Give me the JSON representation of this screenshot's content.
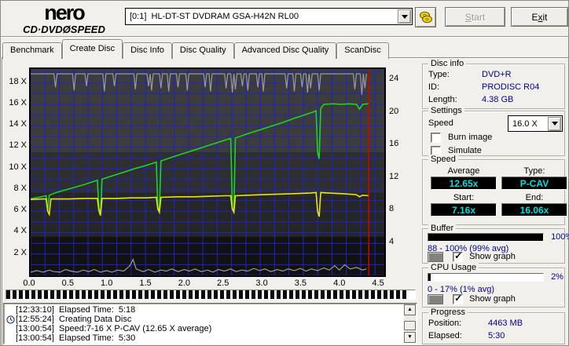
{
  "header": {
    "logo": {
      "line1": "nero",
      "line2_left": "CD·DVD",
      "disc_glyph": "Ø",
      "line2_right": "SPEED"
    },
    "drive_combo": "[0:1]  HL-DT-ST DVDRAM GSA-H42N RL00",
    "start_button": {
      "pre": "",
      "u": "S",
      "rest": "tart"
    },
    "exit_button": {
      "pre": "E",
      "u": "x",
      "rest": "it"
    }
  },
  "tabs": [
    {
      "label": "Benchmark",
      "active": false
    },
    {
      "label": "Create Disc",
      "active": true
    },
    {
      "label": "Disc Info",
      "active": false
    },
    {
      "label": "Disc Quality",
      "active": false
    },
    {
      "label": "Advanced Disc Quality",
      "active": false
    },
    {
      "label": "ScanDisc",
      "active": false
    }
  ],
  "chart_data": {
    "type": "line",
    "x_max": 4.56,
    "y_left_max": 19.3,
    "y_right_max": 25.4,
    "x_ticks": [
      "0.0",
      "0.5",
      "1.0",
      "1.5",
      "2.0",
      "2.5",
      "3.0",
      "3.5",
      "4.0",
      "4.5"
    ],
    "x_tick_values": [
      0,
      0.5,
      1,
      1.5,
      2,
      2.5,
      3,
      3.5,
      4,
      4.5
    ],
    "y_left_ticks": [
      "18 X",
      "16 X",
      "14 X",
      "12 X",
      "10 X",
      "8 X",
      "6 X",
      "4 X",
      "2 X"
    ],
    "y_left_values": [
      18,
      16,
      14,
      12,
      10,
      8,
      6,
      4,
      2
    ],
    "y_right_ticks": [
      "24",
      "20",
      "16",
      "12",
      "8",
      "4"
    ],
    "y_right_values": [
      24,
      20,
      16,
      12,
      8,
      4
    ],
    "grid_color": "#2222c4",
    "grid_dx": 0.185,
    "grid_dy": 1,
    "marker_color": "#d40000",
    "position_marker_x": 4.36,
    "bands": [
      {
        "from": 19.3,
        "to": 11.5,
        "color": "#3c3c3c"
      },
      {
        "from": 11.5,
        "to": 7.7,
        "color": "#2f2f2f"
      },
      {
        "from": 7.7,
        "to": 3.6,
        "color": "#262626"
      },
      {
        "from": 3.6,
        "to": 0,
        "color": "#121212"
      }
    ],
    "series": [
      {
        "name": "write-speed",
        "color": "#1ed51e",
        "width": 1.6,
        "points": [
          [
            0,
            7.16
          ],
          [
            0.1,
            7.3
          ],
          [
            0.2,
            7.45
          ],
          [
            0.22,
            6.0
          ],
          [
            0.24,
            7.5
          ],
          [
            0.35,
            7.8
          ],
          [
            0.5,
            8.1
          ],
          [
            0.65,
            8.4
          ],
          [
            0.8,
            8.75
          ],
          [
            0.86,
            8.9
          ],
          [
            0.88,
            6.3
          ],
          [
            0.9,
            5.8
          ],
          [
            0.92,
            9.0
          ],
          [
            1.05,
            9.3
          ],
          [
            1.2,
            9.65
          ],
          [
            1.35,
            10.0
          ],
          [
            1.5,
            10.3
          ],
          [
            1.62,
            10.6
          ],
          [
            1.64,
            6.4
          ],
          [
            1.66,
            6.1
          ],
          [
            1.68,
            10.7
          ],
          [
            1.8,
            11.0
          ],
          [
            1.95,
            11.35
          ],
          [
            2.1,
            11.7
          ],
          [
            2.25,
            12.05
          ],
          [
            2.4,
            12.4
          ],
          [
            2.55,
            12.75
          ],
          [
            2.58,
            12.8
          ],
          [
            2.6,
            6.3
          ],
          [
            2.62,
            6.0
          ],
          [
            2.64,
            12.85
          ],
          [
            2.8,
            13.25
          ],
          [
            2.95,
            13.6
          ],
          [
            3.1,
            13.95
          ],
          [
            3.25,
            14.3
          ],
          [
            3.4,
            14.7
          ],
          [
            3.55,
            15.05
          ],
          [
            3.65,
            15.3
          ],
          [
            3.68,
            15.4
          ],
          [
            3.7,
            11.5
          ],
          [
            3.72,
            10.9
          ],
          [
            3.74,
            15.6
          ],
          [
            3.78,
            16.0
          ],
          [
            3.9,
            16.05
          ],
          [
            4.0,
            16.0
          ],
          [
            4.1,
            16.05
          ],
          [
            4.2,
            16.0
          ],
          [
            4.24,
            15.55
          ],
          [
            4.28,
            16.0
          ],
          [
            4.36,
            16.06
          ]
        ]
      },
      {
        "name": "rotation-speed",
        "color": "#e8e800",
        "width": 1.6,
        "points": [
          [
            0,
            7.1
          ],
          [
            0.15,
            7.15
          ],
          [
            0.2,
            7.15
          ],
          [
            0.22,
            6.0
          ],
          [
            0.24,
            5.7
          ],
          [
            0.26,
            7.15
          ],
          [
            0.5,
            7.15
          ],
          [
            0.7,
            7.2
          ],
          [
            0.86,
            7.2
          ],
          [
            0.88,
            6.1
          ],
          [
            0.9,
            5.6
          ],
          [
            0.92,
            7.2
          ],
          [
            1.1,
            7.2
          ],
          [
            1.3,
            7.25
          ],
          [
            1.5,
            7.25
          ],
          [
            1.62,
            7.3
          ],
          [
            1.64,
            6.2
          ],
          [
            1.66,
            5.9
          ],
          [
            1.68,
            7.3
          ],
          [
            1.9,
            7.35
          ],
          [
            2.1,
            7.35
          ],
          [
            2.3,
            7.4
          ],
          [
            2.5,
            7.45
          ],
          [
            2.58,
            7.45
          ],
          [
            2.6,
            6.2
          ],
          [
            2.62,
            5.9
          ],
          [
            2.64,
            7.45
          ],
          [
            2.8,
            7.5
          ],
          [
            3.0,
            7.55
          ],
          [
            3.2,
            7.6
          ],
          [
            3.4,
            7.65
          ],
          [
            3.6,
            7.7
          ],
          [
            3.68,
            7.75
          ],
          [
            3.7,
            6.0
          ],
          [
            3.72,
            5.5
          ],
          [
            3.74,
            7.75
          ],
          [
            3.85,
            7.7
          ],
          [
            4.0,
            7.65
          ],
          [
            4.1,
            7.6
          ],
          [
            4.2,
            7.55
          ],
          [
            4.24,
            7.35
          ],
          [
            4.28,
            7.5
          ],
          [
            4.36,
            7.45
          ]
        ]
      },
      {
        "name": "buffer-level",
        "color": "#9a9a9a",
        "width": 1.2,
        "points": [
          [
            0,
            18.85
          ],
          [
            0.3,
            18.85
          ],
          [
            0.32,
            17.6
          ],
          [
            0.34,
            18.85
          ],
          [
            0.54,
            18.85
          ],
          [
            0.56,
            17.3
          ],
          [
            0.58,
            18.85
          ],
          [
            0.7,
            18.85
          ],
          [
            0.72,
            17.7
          ],
          [
            0.74,
            18.85
          ],
          [
            0.93,
            18.85
          ],
          [
            0.95,
            17.2
          ],
          [
            0.97,
            18.85
          ],
          [
            1.06,
            18.85
          ],
          [
            1.08,
            17.7
          ],
          [
            1.1,
            18.85
          ],
          [
            1.33,
            18.85
          ],
          [
            1.35,
            17.4
          ],
          [
            1.37,
            18.85
          ],
          [
            1.5,
            18.85
          ],
          [
            1.52,
            17.7
          ],
          [
            1.54,
            18.85
          ],
          [
            1.56,
            17.3
          ],
          [
            1.58,
            18.85
          ],
          [
            1.66,
            18.85
          ],
          [
            1.68,
            17.5
          ],
          [
            1.7,
            18.85
          ],
          [
            1.76,
            18.85
          ],
          [
            1.78,
            17.2
          ],
          [
            1.8,
            18.85
          ],
          [
            1.88,
            18.85
          ],
          [
            1.9,
            17.6
          ],
          [
            1.92,
            18.85
          ],
          [
            2.0,
            18.85
          ],
          [
            2.02,
            17.3
          ],
          [
            2.04,
            18.85
          ],
          [
            2.23,
            18.85
          ],
          [
            2.25,
            17.6
          ],
          [
            2.27,
            18.85
          ],
          [
            2.3,
            18.85
          ],
          [
            2.32,
            17.2
          ],
          [
            2.34,
            18.85
          ],
          [
            2.5,
            18.85
          ],
          [
            2.52,
            17.5
          ],
          [
            2.54,
            18.85
          ],
          [
            2.58,
            18.85
          ],
          [
            2.6,
            17.1
          ],
          [
            2.62,
            18.85
          ],
          [
            2.64,
            17.4
          ],
          [
            2.66,
            18.85
          ],
          [
            2.71,
            18.85
          ],
          [
            2.73,
            17.7
          ],
          [
            2.75,
            18.85
          ],
          [
            2.78,
            18.85
          ],
          [
            2.8,
            17.3
          ],
          [
            2.82,
            18.85
          ],
          [
            2.91,
            18.85
          ],
          [
            2.93,
            17.6
          ],
          [
            2.95,
            18.85
          ],
          [
            2.98,
            18.85
          ],
          [
            3.0,
            17.2
          ],
          [
            3.02,
            18.85
          ],
          [
            3.28,
            18.85
          ],
          [
            3.3,
            17.5
          ],
          [
            3.32,
            18.85
          ],
          [
            3.38,
            18.85
          ],
          [
            3.4,
            17.2
          ],
          [
            3.42,
            18.85
          ],
          [
            3.48,
            18.85
          ],
          [
            3.5,
            17.6
          ],
          [
            3.52,
            18.85
          ],
          [
            3.55,
            18.85
          ],
          [
            3.57,
            17.1
          ],
          [
            3.59,
            18.85
          ],
          [
            3.61,
            17.5
          ],
          [
            3.63,
            18.85
          ],
          [
            3.7,
            18.85
          ],
          [
            3.72,
            17.3
          ],
          [
            3.74,
            18.85
          ],
          [
            4.16,
            18.85
          ],
          [
            4.18,
            17.4
          ],
          [
            4.2,
            18.85
          ],
          [
            4.25,
            18.85
          ],
          [
            4.27,
            16.9
          ],
          [
            4.29,
            18.85
          ],
          [
            4.31,
            17.5
          ],
          [
            4.33,
            18.85
          ]
        ]
      },
      {
        "name": "cpu-usage",
        "color": "#9a9a9a",
        "width": 1.2,
        "points": [
          [
            0,
            0.3
          ],
          [
            0.08,
            0.45
          ],
          [
            0.16,
            0.3
          ],
          [
            0.24,
            0.5
          ],
          [
            0.3,
            0.35
          ],
          [
            0.38,
            0.3
          ],
          [
            0.45,
            0.55
          ],
          [
            0.52,
            0.4
          ],
          [
            0.6,
            0.3
          ],
          [
            0.68,
            0.5
          ],
          [
            0.75,
            0.35
          ],
          [
            0.82,
            0.55
          ],
          [
            0.9,
            0.3
          ],
          [
            0.98,
            0.45
          ],
          [
            1.05,
            0.3
          ],
          [
            1.12,
            0.5
          ],
          [
            1.2,
            0.4
          ],
          [
            1.28,
            0.9
          ],
          [
            1.32,
            1.5
          ],
          [
            1.36,
            0.6
          ],
          [
            1.45,
            0.35
          ],
          [
            1.52,
            0.55
          ],
          [
            1.6,
            0.3
          ],
          [
            1.68,
            0.5
          ],
          [
            1.75,
            0.4
          ],
          [
            1.82,
            0.6
          ],
          [
            1.9,
            0.35
          ],
          [
            1.98,
            0.55
          ],
          [
            2.05,
            0.4
          ],
          [
            2.12,
            0.6
          ],
          [
            2.2,
            0.35
          ],
          [
            2.28,
            0.5
          ],
          [
            2.35,
            0.3
          ],
          [
            2.42,
            0.55
          ],
          [
            2.5,
            0.4
          ],
          [
            2.58,
            0.6
          ],
          [
            2.65,
            0.35
          ],
          [
            2.72,
            0.5
          ],
          [
            2.8,
            0.4
          ],
          [
            2.88,
            0.65
          ],
          [
            2.95,
            0.45
          ],
          [
            3.02,
            0.6
          ],
          [
            3.1,
            0.35
          ],
          [
            3.18,
            0.55
          ],
          [
            3.25,
            0.4
          ],
          [
            3.32,
            0.6
          ],
          [
            3.4,
            0.45
          ],
          [
            3.48,
            0.65
          ],
          [
            3.55,
            0.4
          ],
          [
            3.62,
            0.6
          ],
          [
            3.7,
            0.45
          ],
          [
            3.78,
            0.7
          ],
          [
            3.85,
            0.5
          ],
          [
            3.92,
            0.9
          ],
          [
            3.98,
            0.5
          ],
          [
            4.05,
            1.0
          ],
          [
            4.12,
            0.6
          ],
          [
            4.2,
            0.75
          ],
          [
            4.28,
            0.5
          ],
          [
            4.33,
            0.6
          ]
        ]
      }
    ]
  },
  "burn_progress_percent": 98.5,
  "panels": {
    "disc_info": {
      "title": "Disc info",
      "rows": [
        {
          "label": "Type:",
          "value": "DVD+R"
        },
        {
          "label": "ID:",
          "value": "PRODISC R04"
        },
        {
          "label": "Length:",
          "value": "4.38 GB"
        }
      ]
    },
    "settings": {
      "title": "Settings",
      "speed_label": "Speed",
      "speed_value": "16.0 X",
      "checkboxes": [
        {
          "label": "Burn image",
          "checked": false
        },
        {
          "label": "Simulate",
          "checked": false
        }
      ]
    },
    "speed": {
      "title": "Speed",
      "cells": [
        {
          "label": "Average",
          "value": "12.65x"
        },
        {
          "label": "Type:",
          "value": "P-CAV"
        },
        {
          "label": "Start:",
          "value": "7.16x"
        },
        {
          "label": "End:",
          "value": "16.06x"
        }
      ]
    },
    "buffer": {
      "title": "Buffer",
      "percent": 100,
      "percent_label": "100%",
      "range": "88 - 100% (99% avg)",
      "show_graph": "Show graph",
      "checked": true
    },
    "cpu": {
      "title": "CPU Usage",
      "percent": 2,
      "percent_label": "2%",
      "range": "0 - 17% (1% avg)",
      "show_graph": "Show graph",
      "checked": true
    },
    "progress": {
      "title": "Progress",
      "rows": [
        {
          "label": "Position:",
          "value": "4463 MB"
        },
        {
          "label": "Elapsed:",
          "value": "5:30"
        }
      ]
    }
  },
  "log": {
    "lines": [
      {
        "time": "[12:33:10]",
        "text": "Elapsed Time:  5:18",
        "icon": false
      },
      {
        "time": "[12:55:24]",
        "text": "Creating Data Disc",
        "icon": true
      },
      {
        "time": "[13:00:54]",
        "text": "Speed:7-16 X P-CAV (12.65 X average)",
        "icon": false
      },
      {
        "time": "[13:00:54]",
        "text": "Elapsed Time:  5:30",
        "icon": false
      }
    ]
  }
}
